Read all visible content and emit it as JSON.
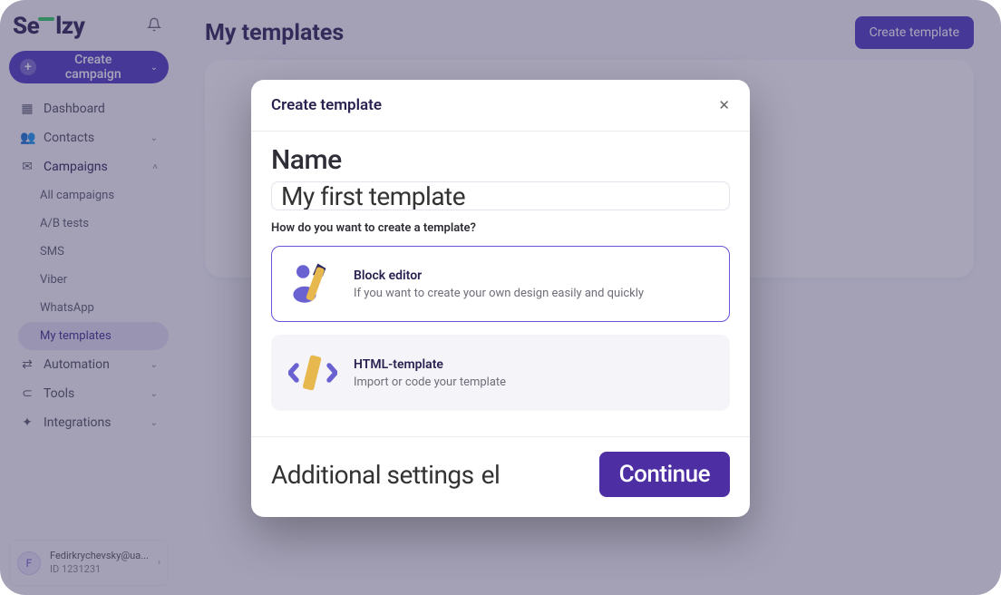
{
  "logo": "Sēlzy",
  "create_campaign": "Create campaign",
  "nav": {
    "dashboard": "Dashboard",
    "contacts": "Contacts",
    "campaigns": "Campaigns",
    "automation": "Automation",
    "tools": "Tools",
    "integrations": "Integrations"
  },
  "sub": {
    "all_campaigns": "All campaigns",
    "ab_tests": "A/B tests",
    "sms": "SMS",
    "viber": "Viber",
    "whatsapp": "WhatsApp",
    "my_templates": "My templates"
  },
  "user": {
    "initial": "F",
    "email": "Fedirkrychevsky@ua...",
    "id_line": "ID 1231231"
  },
  "page": {
    "title": "My templates",
    "create_btn": "Create template"
  },
  "modal": {
    "title": "Create template",
    "name_label": "Name",
    "name_value": "My first template",
    "how": "How do you want to create a template?",
    "opt1_title": "Block editor",
    "opt1_desc": "If you want to create your own design easily and quickly",
    "opt2_title": "HTML-template",
    "opt2_desc": "Import or code your template",
    "additional": "Additional settings",
    "additional_suffix": "el",
    "continue": "Continue"
  }
}
